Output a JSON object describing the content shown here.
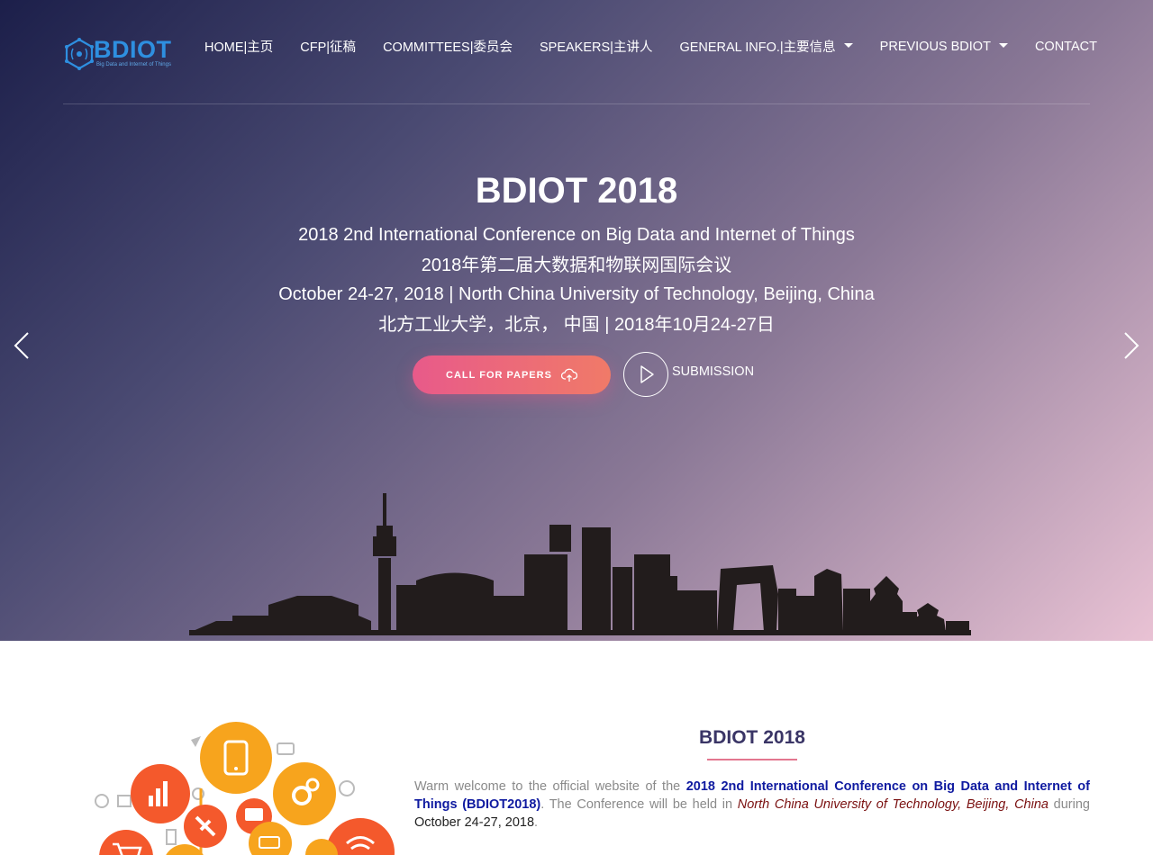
{
  "logo": {
    "text": "BDIOT",
    "tagline": "Big Data and Internet of Things"
  },
  "nav": {
    "items": [
      {
        "label": "HOME|主页"
      },
      {
        "label": "CFP|征稿"
      },
      {
        "label": "COMMITTEES|委员会"
      },
      {
        "label": "SPEAKERS|主讲人"
      },
      {
        "label": "GENERAL INFO.|主要信息",
        "dropdown": true
      },
      {
        "label": "PREVIOUS BDIOT",
        "dropdown": true
      },
      {
        "label": "CONTACT"
      }
    ]
  },
  "hero": {
    "title": "BDIOT 2018",
    "subtitle_en": "2018 2nd International Conference on Big Data and Internet of Things",
    "subtitle_cn": "2018年第二届大数据和物联网国际会议",
    "date_en": "October 24-27, 2018 | North China University of Technology, Beijing, China",
    "date_cn": "北方工业大学，北京， 中国 | 2018年10月24-27日",
    "cfp_button": "CALL FOR PAPERS",
    "submission_label": "SUBMISSION"
  },
  "about": {
    "title": "BDIOT 2018",
    "text_intro": "Warm welcome to the official website of the ",
    "conference_name": "2018 2nd International Conference on Big Data and Internet of Things (BDIOT2018)",
    "text_mid": ". The Conference will be held in ",
    "location": "North China University of Technology, Beijing, China",
    "text_during": " during ",
    "dates": "October 24-27, 2018",
    "text_end": "."
  },
  "colors": {
    "accent_pink": "#e85a8a",
    "logo_blue": "#2e8fe0",
    "heading_purple": "#3a3566",
    "highlight_blue": "#0f1aa0",
    "location_red": "#7a1010"
  },
  "icons": [
    "cloud-upload-icon",
    "play-icon",
    "chevron-left-icon",
    "chevron-right-icon",
    "hexagon-logo-icon"
  ]
}
